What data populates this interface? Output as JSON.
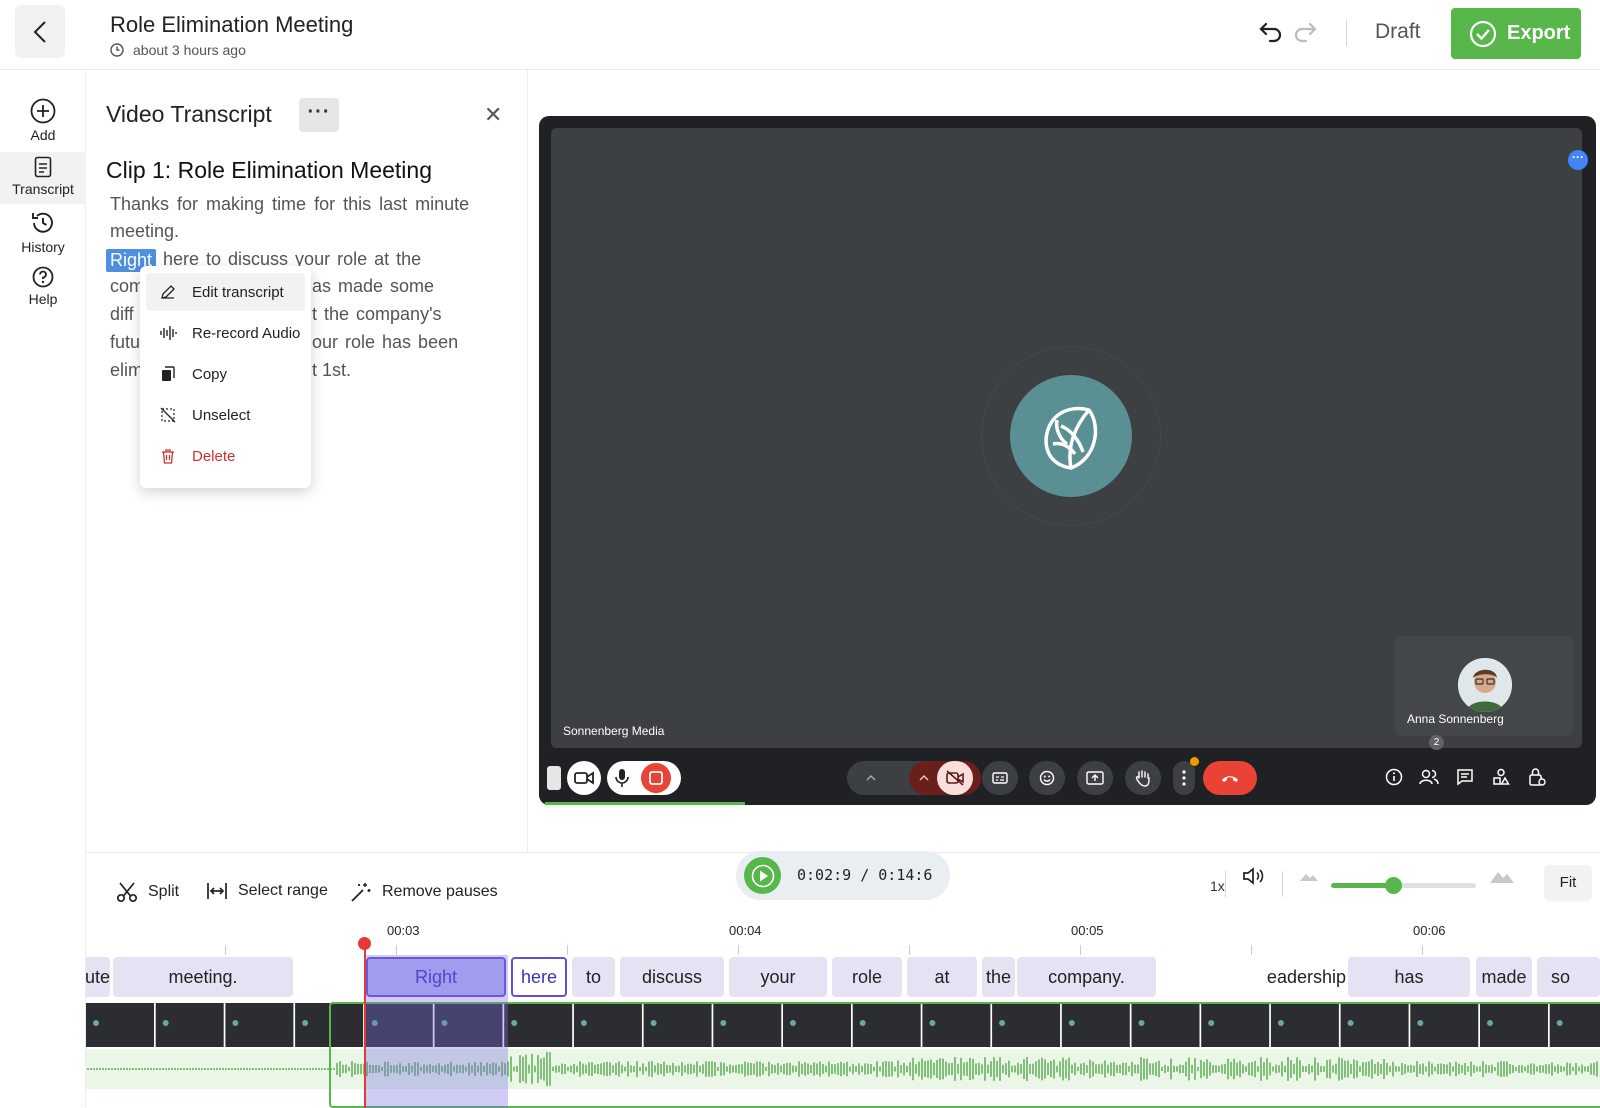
{
  "header": {
    "back_label": "‹",
    "title": "Role Elimination Meeting",
    "timestamp": "about 3 hours ago",
    "status": "Draft",
    "export_label": "Export"
  },
  "rail": {
    "items": [
      {
        "label": "Add",
        "icon": "plus-circle-icon"
      },
      {
        "label": "Transcript",
        "icon": "document-icon"
      },
      {
        "label": "History",
        "icon": "history-icon"
      },
      {
        "label": "Help",
        "icon": "help-icon"
      }
    ]
  },
  "transcript": {
    "panel_title": "Video Transcript",
    "more_label": "···",
    "close_label": "✕",
    "clip_title": "Clip 1: Role Elimination Meeting",
    "lines": [
      "Thanks for making time for this last minute",
      "meeting.",
      "here to discuss your role at the",
      "company. Leadership has made some",
      "difficult decisions about the company's",
      "future and unfortunately your role has been",
      "eliminated effective August 1st."
    ],
    "visible_lines": [
      "Thanks  for  making  time  for  this  last  minute",
      "meeting.",
      "here  to  discuss  your  role  at  the",
      "com",
      "as  made  some",
      "diff",
      "t  the  company's",
      "futu",
      "our  role  has  been",
      "elim",
      "t  1st."
    ],
    "selected_word": "Right"
  },
  "context_menu": {
    "items": [
      {
        "label": "Edit transcript",
        "icon": "pencil-icon"
      },
      {
        "label": "Re-record Audio",
        "icon": "waveform-icon"
      },
      {
        "label": "Copy",
        "icon": "copy-icon"
      },
      {
        "label": "Unselect",
        "icon": "unselect-icon"
      },
      {
        "label": "Delete",
        "icon": "trash-icon"
      }
    ]
  },
  "video": {
    "left_label": "Sonnenberg Media",
    "self_name": "Anna Sonnenberg",
    "participants_count": "2",
    "more_label": "···"
  },
  "toolbar": {
    "split_label": "Split",
    "select_range_label": "Select range",
    "remove_pauses_label": "Remove pauses",
    "time_readout": "0:02:9 / 0:14:6",
    "speed": "1x",
    "zoom_level": 0.43,
    "fit_label": "Fit"
  },
  "timeline": {
    "ticks": [
      "00:03",
      "00:04",
      "00:05",
      "00:06"
    ],
    "words": [
      "ute",
      "meeting.",
      "Right",
      "here",
      "to",
      "discuss",
      "your",
      "role",
      "at",
      "the",
      "company.",
      "Leadership",
      "has",
      "made",
      "so"
    ]
  },
  "colors": {
    "accent_green": "#57b74a",
    "selection_purple": "#5b52d6",
    "delete_red": "#d32f2f",
    "playhead_red": "#e53935",
    "end_call_red": "#ea4335"
  }
}
